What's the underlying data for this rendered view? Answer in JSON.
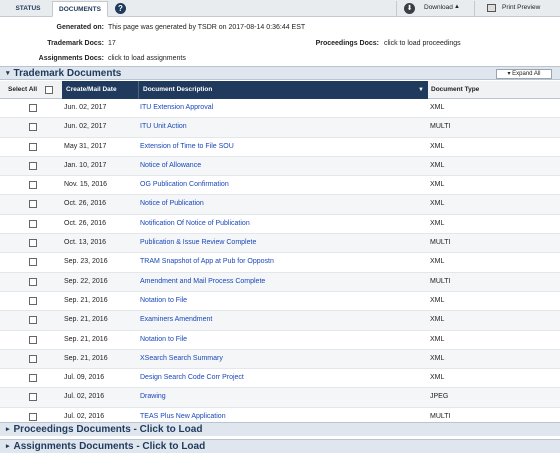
{
  "tabs": {
    "status": "STATUS",
    "documents": "DOCUMENTS",
    "help_icon": "?"
  },
  "toolbar": {
    "download": "Download",
    "print_preview": "Print Preview"
  },
  "info": {
    "generated_label": "Generated on:",
    "generated_value": "This page was generated by TSDR on 2017-08-14 0:36:44 EST",
    "trademark_docs_label": "Trademark Docs:",
    "trademark_docs_value": "17",
    "proceedings_docs_label": "Proceedings Docs:",
    "proceedings_docs_link": "click to load proceedings",
    "assignments_docs_label": "Assignments Docs:",
    "assignments_docs_link": "click to load assignments"
  },
  "section": {
    "title": "Trademark Documents",
    "expand_all": "Expand All"
  },
  "table": {
    "headers": {
      "select_all": "Select All",
      "date": "Create/Mail Date",
      "description": "Document Description",
      "type": "Document Type"
    },
    "rows": [
      {
        "date": "Jun. 02, 2017",
        "desc": "ITU Extension Approval",
        "type": "XML"
      },
      {
        "date": "Jun. 02, 2017",
        "desc": "ITU Unit Action",
        "type": "MULTI"
      },
      {
        "date": "May 31, 2017",
        "desc": "Extension of Time to File SOU",
        "type": "XML"
      },
      {
        "date": "Jan. 10, 2017",
        "desc": "Notice of Allowance",
        "type": "XML"
      },
      {
        "date": "Nov. 15, 2016",
        "desc": "OG Publication Confirmation",
        "type": "XML"
      },
      {
        "date": "Oct. 26, 2016",
        "desc": "Notice of Publication",
        "type": "XML"
      },
      {
        "date": "Oct. 26, 2016",
        "desc": "Notification Of Notice of Publication",
        "type": "XML"
      },
      {
        "date": "Oct. 13, 2016",
        "desc": "Publication & Issue Review Complete",
        "type": "MULTI"
      },
      {
        "date": "Sep. 23, 2016",
        "desc": "TRAM Snapshot of App at Pub for Oppostn",
        "type": "XML"
      },
      {
        "date": "Sep. 22, 2016",
        "desc": "Amendment and Mail Process Complete",
        "type": "MULTI"
      },
      {
        "date": "Sep. 21, 2016",
        "desc": "Notation to File",
        "type": "XML"
      },
      {
        "date": "Sep. 21, 2016",
        "desc": "Examiners Amendment",
        "type": "XML"
      },
      {
        "date": "Sep. 21, 2016",
        "desc": "Notation to File",
        "type": "XML"
      },
      {
        "date": "Sep. 21, 2016",
        "desc": "XSearch Search Summary",
        "type": "XML"
      },
      {
        "date": "Jul. 09, 2016",
        "desc": "Design Search Code Corr Project",
        "type": "XML"
      },
      {
        "date": "Jul. 02, 2016",
        "desc": "Drawing",
        "type": "JPEG"
      },
      {
        "date": "Jul. 02, 2016",
        "desc": "TEAS Plus New Application",
        "type": "MULTI"
      }
    ]
  },
  "collapsed": {
    "proceedings": "Proceedings Documents - Click to Load",
    "assignments": "Assignments Documents - Click to Load"
  },
  "icons": {
    "download": "download-icon",
    "print": "printer-icon",
    "caret_down": "▾",
    "caret_right": "▸"
  }
}
